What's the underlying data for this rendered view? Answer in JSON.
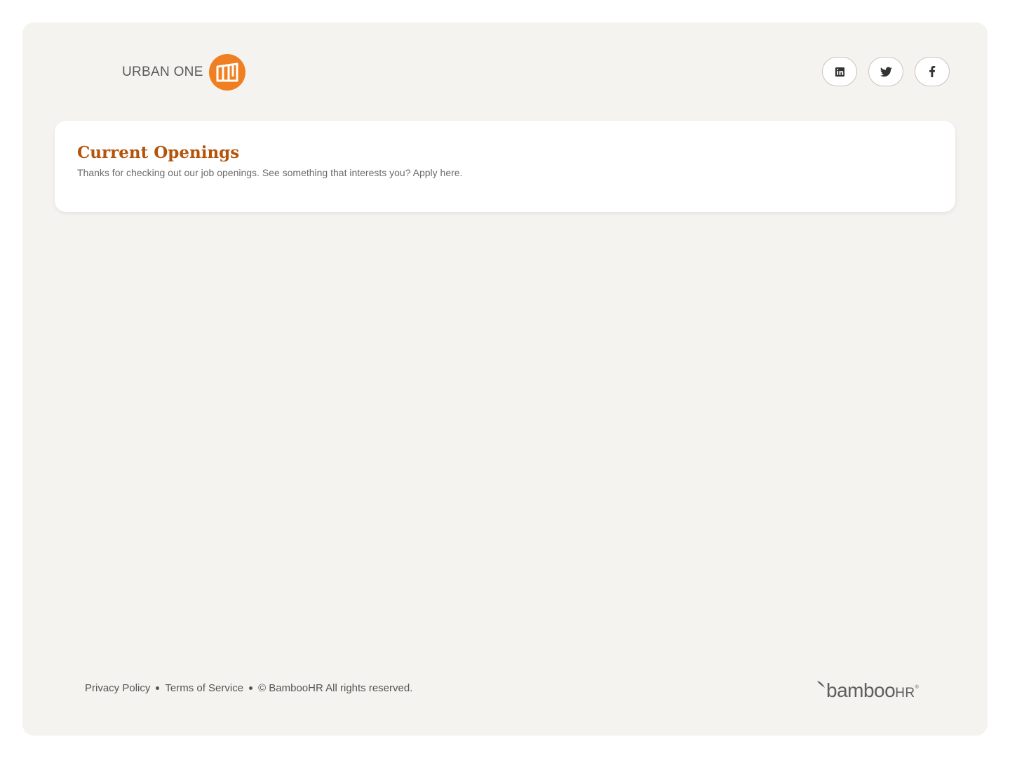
{
  "brand": {
    "name": "URBAN ONE",
    "accent_color": "#f07f22"
  },
  "socials": [
    {
      "name": "linkedin-icon"
    },
    {
      "name": "twitter-icon"
    },
    {
      "name": "facebook-icon"
    }
  ],
  "openings": {
    "title": "Current Openings",
    "subtitle": "Thanks for checking out our job openings. See something that interests you? Apply here.",
    "title_color": "#b4530a"
  },
  "footer": {
    "privacy_label": "Privacy Policy",
    "terms_label": "Terms of Service",
    "copyright": "© BambooHR All rights reserved."
  },
  "powered_by": {
    "main": "bamboo",
    "suffix": "HR",
    "trademark": "®"
  }
}
